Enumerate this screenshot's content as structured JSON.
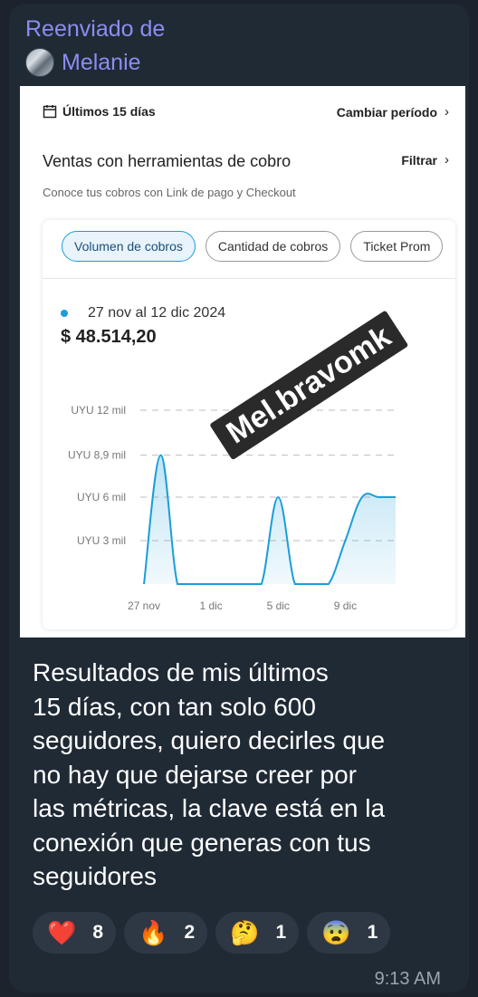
{
  "forward": {
    "label": "Reenviado de",
    "name": "Melanie"
  },
  "screenshot": {
    "period": "Últimos 15 días",
    "change_period": "Cambiar período",
    "section_title": "Ventas con herramientas de cobro",
    "filter": "Filtrar",
    "subtitle": "Conoce tus cobros con Link de pago y Checkout",
    "chips": [
      "Volumen de cobros",
      "Cantidad de cobros",
      "Ticket Prom"
    ],
    "range": "27 nov al 12 dic 2024",
    "total": "$ 48.514,20",
    "watermark": "Mel.bravomk"
  },
  "chart_data": {
    "type": "area",
    "x": [
      "27 nov",
      "28 nov",
      "29 nov",
      "30 nov",
      "1 dic",
      "2 dic",
      "3 dic",
      "4 dic",
      "5 dic",
      "6 dic",
      "7 dic",
      "8 dic",
      "9 dic",
      "10 dic",
      "11 dic",
      "12 dic"
    ],
    "series": [
      {
        "values": [
          0,
          8900,
          0,
          0,
          0,
          0,
          0,
          0,
          6000,
          0,
          0,
          0,
          3000,
          6000,
          6000,
          6000
        ]
      }
    ],
    "yticks": [
      {
        "value": 3000,
        "label": "UYU 3 mil"
      },
      {
        "value": 6000,
        "label": "UYU 6 mil"
      },
      {
        "value": 8900,
        "label": "UYU 8,9 mil"
      },
      {
        "value": 12000,
        "label": "UYU 12 mil"
      }
    ],
    "xticks": [
      "27 nov",
      "1 dic",
      "5 dic",
      "9 dic"
    ],
    "ylim": [
      0,
      12000
    ],
    "grid": true,
    "color": "#1a9ed9"
  },
  "message": {
    "lines": [
      "Resultados de mis últimos",
      "15 días, con tan solo 600",
      "seguidores, quiero decirles que",
      "no hay que dejarse creer por",
      "las métricas, la clave está en la",
      "conexión que generas con tus",
      "seguidores"
    ]
  },
  "reactions": [
    {
      "emoji": "❤️",
      "icon": "heart-icon",
      "count": "8"
    },
    {
      "emoji": "🔥",
      "icon": "fire-icon",
      "count": "2"
    },
    {
      "emoji": "🤔",
      "icon": "thinking-face-icon",
      "count": "1"
    },
    {
      "emoji": "😨",
      "icon": "fearful-face-icon",
      "count": "1"
    }
  ],
  "time": "9:13 AM"
}
